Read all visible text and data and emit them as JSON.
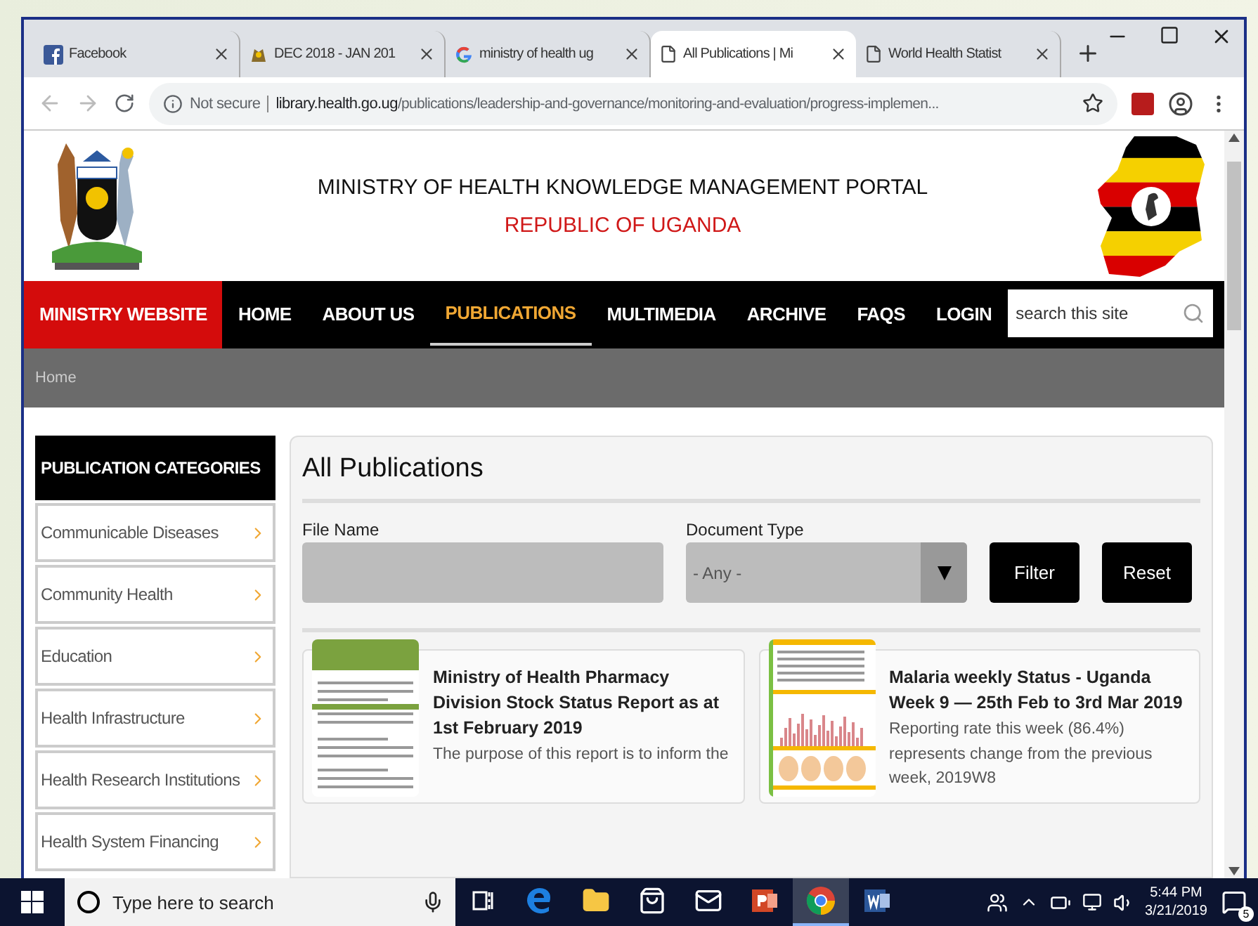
{
  "browser": {
    "tabs": [
      {
        "title": "Facebook",
        "kind": "facebook",
        "selected": false
      },
      {
        "title": "DEC 2018 - JAN 201",
        "kind": "crest",
        "selected": false
      },
      {
        "title": "ministry of health ug",
        "kind": "google",
        "selected": false
      },
      {
        "title": "All Publications | Mi",
        "kind": "page",
        "selected": true
      },
      {
        "title": "World Health Statist",
        "kind": "page",
        "selected": false
      }
    ],
    "address": {
      "security": "Not secure",
      "domain": "library.health.go.ug",
      "path": "/publications/leadership-and-governance/monitoring-and-evaluation/progress-implemen..."
    }
  },
  "site": {
    "title": "MINISTRY OF HEALTH KNOWLEDGE MANAGEMENT PORTAL",
    "subtitle": "REPUBLIC OF UGANDA",
    "nav": [
      {
        "label": "MINISTRY WEBSITE",
        "kind": "highlight",
        "selected": false
      },
      {
        "label": "HOME",
        "kind": "link",
        "selected": false
      },
      {
        "label": "ABOUT US",
        "kind": "link",
        "selected": false
      },
      {
        "label": "PUBLICATIONS",
        "kind": "link",
        "selected": true
      },
      {
        "label": "MULTIMEDIA",
        "kind": "link",
        "selected": false
      },
      {
        "label": "ARCHIVE",
        "kind": "link",
        "selected": false
      },
      {
        "label": "FAQS",
        "kind": "link",
        "selected": false
      },
      {
        "label": "LOGIN",
        "kind": "link",
        "selected": false
      }
    ],
    "search": {
      "placeholder": "search this site"
    },
    "breadcrumb": "Home"
  },
  "sidebar": {
    "heading": "PUBLICATION CATEGORIES",
    "items": [
      "Communicable Diseases",
      "Community Health",
      "Education",
      "Health Infrastructure",
      "Health Research Institutions",
      "Health System Financing"
    ]
  },
  "main": {
    "title": "All Publications",
    "filters": {
      "file_name": {
        "label": "File Name"
      },
      "document_type": {
        "label": "Document Type",
        "value": "- Any -"
      },
      "buttons": [
        "Filter",
        "Reset"
      ]
    },
    "publications": [
      {
        "title": "Ministry of Health Pharmacy Division Stock Status Report as at 1st February 2019",
        "excerpt": "The purpose of this report is to inform the",
        "kind": "report"
      },
      {
        "title": "Malaria weekly Status - Uganda Week 9 — 25th Feb to 3rd Mar 2019",
        "excerpt": "Reporting rate this week (86.4%) represents change from the previous week, 2019W8",
        "kind": "bulletin"
      }
    ]
  },
  "taskbar": {
    "search": {
      "placeholder": "Type here to search"
    },
    "apps": [
      {
        "kind": "taskview",
        "active": false
      },
      {
        "kind": "edge",
        "active": false
      },
      {
        "kind": "folder",
        "active": false
      },
      {
        "kind": "store",
        "active": false
      },
      {
        "kind": "mail",
        "active": false
      },
      {
        "kind": "powerpoint",
        "active": false
      },
      {
        "kind": "chrome",
        "active": true
      },
      {
        "kind": "word",
        "active": false
      }
    ],
    "time": "5:44 PM",
    "date": "3/21/2019",
    "notifications": "5"
  }
}
